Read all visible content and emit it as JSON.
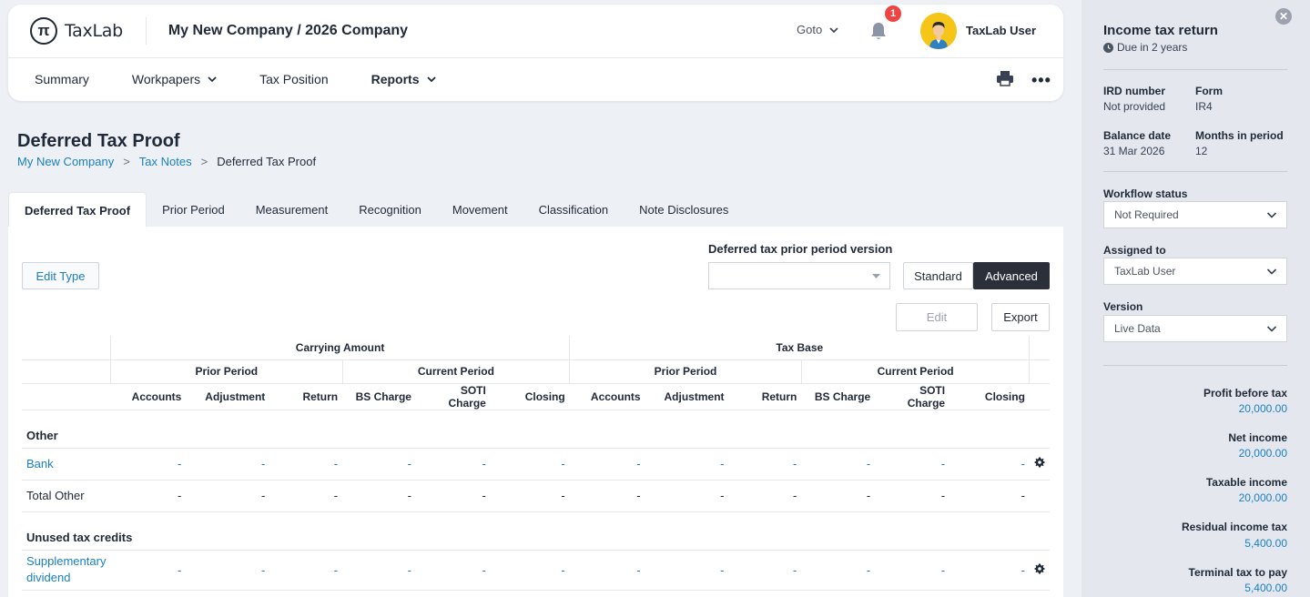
{
  "header": {
    "logo_symbol": "π",
    "logo_text": "TaxLab",
    "company": "My New Company / 2026 Company",
    "goto_label": "Goto",
    "notification_count": "1",
    "user_name": "TaxLab User"
  },
  "nav": {
    "items": [
      {
        "label": "Summary"
      },
      {
        "label": "Workpapers"
      },
      {
        "label": "Tax Position"
      },
      {
        "label": "Reports"
      }
    ]
  },
  "page": {
    "title": "Deferred Tax Proof",
    "breadcrumb": [
      "My New Company",
      "Tax Notes",
      "Deferred Tax Proof"
    ],
    "tabs": [
      "Deferred Tax Proof",
      "Prior Period",
      "Measurement",
      "Recognition",
      "Movement",
      "Classification",
      "Note Disclosures"
    ]
  },
  "toolbar": {
    "edit_type": "Edit Type",
    "version_label": "Deferred tax prior period version",
    "version_value": "",
    "standard": "Standard",
    "advanced": "Advanced",
    "edit": "Edit",
    "export": "Export"
  },
  "table": {
    "groups": [
      "Carrying Amount",
      "Tax Base"
    ],
    "subgroups": [
      "Prior Period",
      "Current Period",
      "Prior Period",
      "Current Period"
    ],
    "columns": [
      "Accounts",
      "Adjustment",
      "Return",
      "BS Charge",
      "SOTI Charge",
      "Closing",
      "Accounts",
      "Adjustment",
      "Return",
      "BS Charge",
      "SOTI Charge",
      "Closing"
    ],
    "sections": [
      {
        "title": "Other",
        "rows": [
          {
            "name": "Bank",
            "cells": [
              "-",
              "-",
              "-",
              "-",
              "-",
              "-",
              "-",
              "-",
              "-",
              "-",
              "-",
              "-"
            ]
          },
          {
            "name": "Total Other",
            "cells": [
              "-",
              "-",
              "-",
              "-",
              "-",
              "-",
              "-",
              "-",
              "-",
              "-",
              "-",
              "-"
            ]
          }
        ]
      },
      {
        "title": "Unused tax credits",
        "rows": [
          {
            "name": "Supplementary dividend",
            "cells": [
              "-",
              "-",
              "-",
              "-",
              "-",
              "-",
              "-",
              "-",
              "-",
              "-",
              "-",
              "-"
            ]
          }
        ]
      }
    ]
  },
  "panel": {
    "title": "Income tax return",
    "due": "Due in 2 years",
    "ird_label": "IRD number",
    "ird_value": "Not provided",
    "form_label": "Form",
    "form_value": "IR4",
    "balance_label": "Balance date",
    "balance_value": "31 Mar 2026",
    "months_label": "Months in period",
    "months_value": "12",
    "workflow_label": "Workflow status",
    "workflow_value": "Not Required",
    "assigned_label": "Assigned to",
    "assigned_value": "TaxLab User",
    "version_label": "Version",
    "version_value": "Live Data",
    "financials": [
      {
        "label": "Profit before tax",
        "value": "20,000.00"
      },
      {
        "label": "Net income",
        "value": "20,000.00"
      },
      {
        "label": "Taxable income",
        "value": "20,000.00"
      },
      {
        "label": "Residual income tax",
        "value": "5,400.00"
      },
      {
        "label": "Terminal tax to pay",
        "value": "5,400.00"
      }
    ]
  },
  "colors": {
    "link": "#1a7fc1",
    "dark_button": "#2b2f3a",
    "badge": "#ef4444",
    "panel_bg": "#e4e8ee"
  }
}
